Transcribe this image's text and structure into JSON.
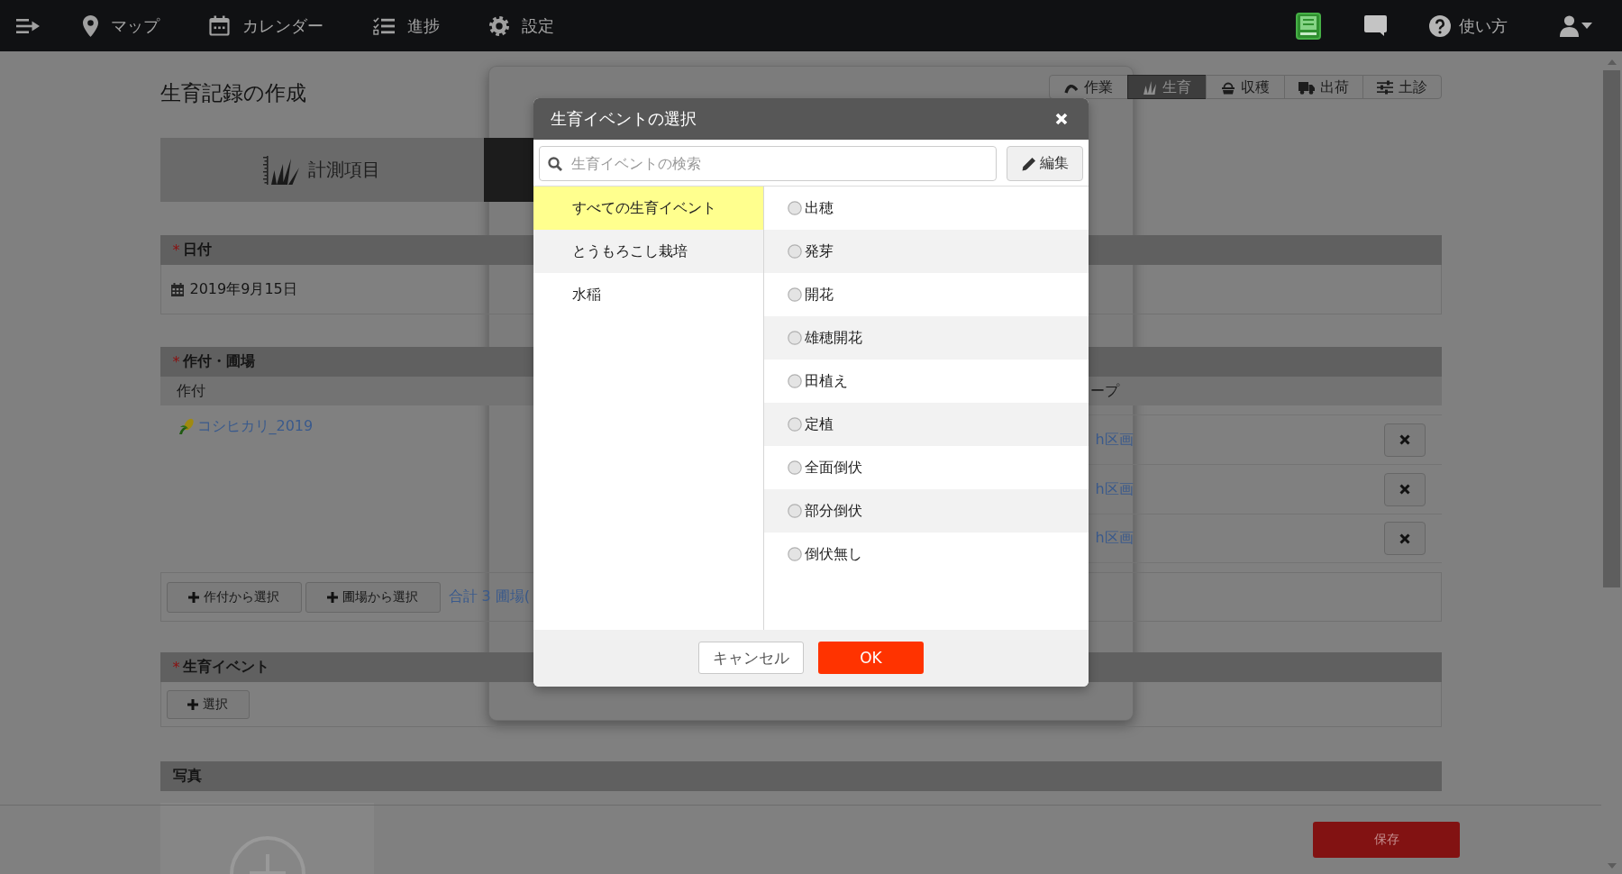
{
  "top_bar": {
    "nav": [
      {
        "label": "マップ"
      },
      {
        "label": "カレンダー"
      },
      {
        "label": "進捗"
      },
      {
        "label": "設定"
      }
    ],
    "help": {
      "label": "使い方"
    }
  },
  "page": {
    "title": "生育記録の作成",
    "record_types": [
      {
        "label": "作業",
        "selected": false
      },
      {
        "label": "生育",
        "selected": true
      },
      {
        "label": "収穫",
        "selected": false
      },
      {
        "label": "出荷",
        "selected": false
      },
      {
        "label": "土診",
        "selected": false
      }
    ],
    "tabs": [
      {
        "label": "計測項目",
        "selected": false
      },
      {
        "selected": true
      }
    ],
    "date_section": {
      "required_mark": "*",
      "title": "日付",
      "value": "2019年9月15日"
    },
    "field_section": {
      "required_mark": "*",
      "title": "作付・圃場",
      "columns": [
        "作付",
        "ープ"
      ],
      "crop": "コシヒカリ_2019",
      "plots": [
        {
          "label": "h区画"
        },
        {
          "label": "h区画"
        },
        {
          "label": "h区画"
        }
      ],
      "buttons": [
        "作付から選択",
        "圃場から選択"
      ],
      "total_link": "合計 3 圃場("
    },
    "event_section": {
      "required_mark": "*",
      "title": "生育イベント",
      "button": "選択"
    },
    "photo_section": {
      "title": "写真"
    }
  },
  "save_button": "保存",
  "dialog": {
    "title": "生育イベントの選択",
    "search": {
      "placeholder": "生育イベントの検索"
    },
    "edit_button": "編集",
    "categories": [
      {
        "label": "すべての生育イベント",
        "selected": true
      },
      {
        "label": "とうもろこし栽培",
        "selected": false
      },
      {
        "label": "水稲",
        "selected": false
      }
    ],
    "events": [
      {
        "label": "出穂",
        "selected": false
      },
      {
        "label": "発芽",
        "selected": false
      },
      {
        "label": "開花",
        "selected": false
      },
      {
        "label": "雄穂開花",
        "selected": false
      },
      {
        "label": "田植え",
        "selected": false
      },
      {
        "label": "定植",
        "selected": false
      },
      {
        "label": "全面倒伏",
        "selected": false
      },
      {
        "label": "部分倒伏",
        "selected": false
      },
      {
        "label": "倒伏無し",
        "selected": false
      }
    ],
    "buttons": [
      {
        "label": "キャンセル",
        "kind": "secondary"
      },
      {
        "label": "OK",
        "kind": "primary"
      }
    ]
  }
}
